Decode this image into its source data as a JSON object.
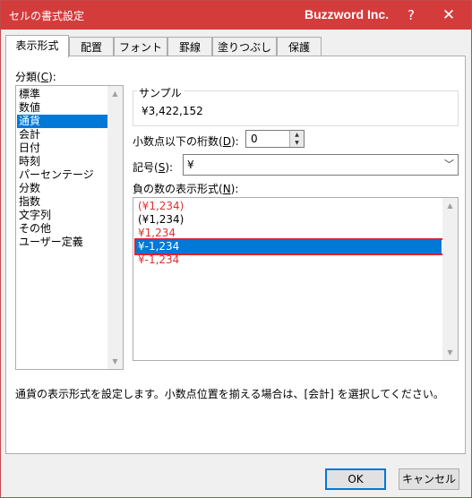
{
  "window": {
    "title": "セルの書式設定",
    "brand": "Buzzword Inc.",
    "help_label": "?",
    "close_label": "✕"
  },
  "tabs": [
    {
      "label": "表示形式",
      "active": true
    },
    {
      "label": "配置"
    },
    {
      "label": "フォント"
    },
    {
      "label": "罫線"
    },
    {
      "label": "塗りつぶし"
    },
    {
      "label": "保護"
    }
  ],
  "category": {
    "label_pre": "分類(",
    "label_key": "C",
    "label_post": "):",
    "items": [
      "標準",
      "数値",
      "通貨",
      "会計",
      "日付",
      "時刻",
      "パーセンテージ",
      "分数",
      "指数",
      "文字列",
      "その他",
      "ユーザー定義"
    ],
    "selected": "通貨"
  },
  "sample": {
    "label": "サンプル",
    "value": "¥3,422,152"
  },
  "decimals": {
    "label_pre": "小数点以下の桁数(",
    "label_key": "D",
    "label_post": "):",
    "value": "0"
  },
  "symbol": {
    "label_pre": "記号(",
    "label_key": "S",
    "label_post": "):",
    "value": "¥"
  },
  "negative": {
    "label_pre": "負の数の表示形式(",
    "label_key": "N",
    "label_post": "):",
    "items": [
      {
        "text": "(¥1,234)",
        "color": "#e03030"
      },
      {
        "text": "(¥1,234)",
        "color": "#000000"
      },
      {
        "text": "¥1,234",
        "color": "#e03030"
      },
      {
        "text": "¥-1,234",
        "color": "#000000",
        "selected": true
      },
      {
        "text": "¥-1,234",
        "color": "#e03030"
      }
    ]
  },
  "description": "通貨の表示形式を設定します。小数点位置を揃える場合は、[会計] を選択してください。",
  "buttons": {
    "ok": "OK",
    "cancel": "キャンセル"
  },
  "colors": {
    "titlebar": "#d43c3c",
    "selection": "#0078d7",
    "negative_red": "#e03030",
    "focus_frame": "#e0212b"
  }
}
